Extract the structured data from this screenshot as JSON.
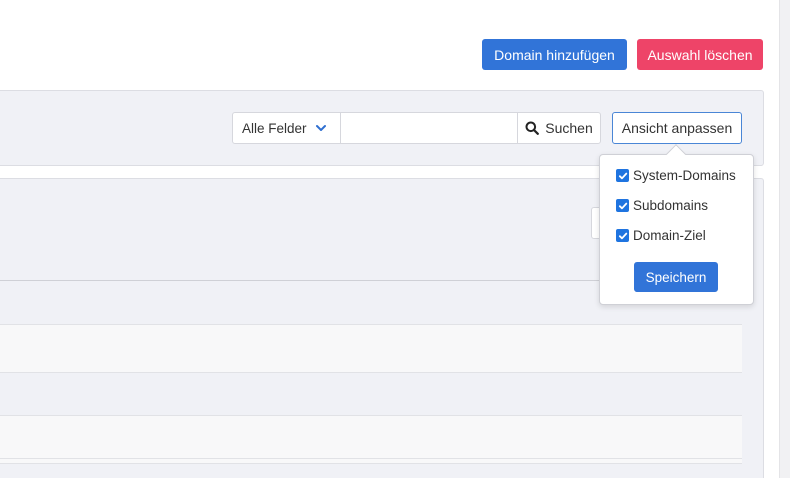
{
  "toolbar": {
    "add_domain_label": "Domain hinzufügen",
    "delete_selection_label": "Auswahl löschen"
  },
  "filter": {
    "field_select_value": "Alle Felder",
    "search_value": "",
    "search_button_label": "Suchen",
    "view_button_label": "Ansicht anpassen"
  },
  "view_popover": {
    "options": [
      {
        "label": "System-Domains",
        "checked": true
      },
      {
        "label": "Subdomains",
        "checked": true
      },
      {
        "label": "Domain-Ziel",
        "checked": true
      }
    ],
    "save_label": "Speichern"
  },
  "colors": {
    "primary": "#3174d8",
    "danger": "#ee4468",
    "panel_bg": "#f0f1f6"
  },
  "icons": [
    "chevron-down-icon",
    "search-icon",
    "checkbox-checked-icon"
  ]
}
